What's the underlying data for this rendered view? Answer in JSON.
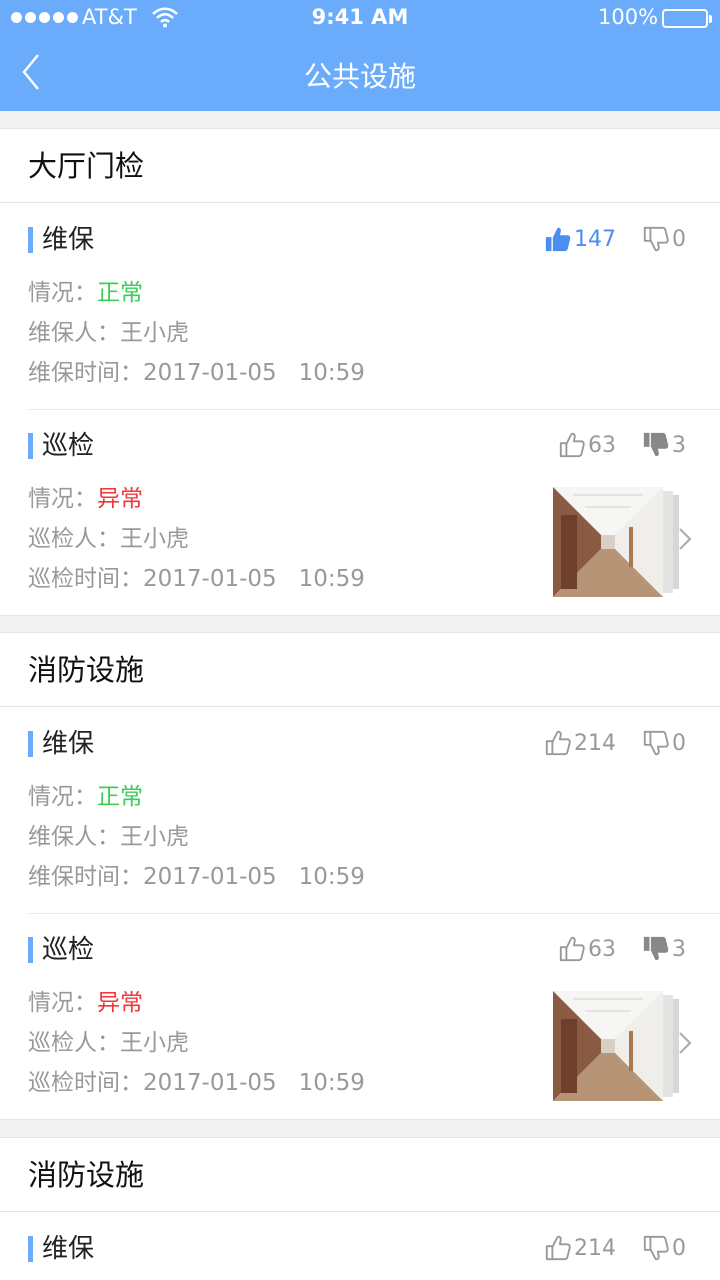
{
  "status_bar": {
    "carrier": "AT&T",
    "time": "9:41 AM",
    "battery": "100%"
  },
  "nav": {
    "title": "公共设施"
  },
  "sections": [
    {
      "title": "大厅门检",
      "records": [
        {
          "title": "维保",
          "status_label": "情况：",
          "status": "正常",
          "person_label": "维保人：",
          "person": "王小虎",
          "time_label": "维保时间：",
          "time": "2017-01-05   10:59",
          "likes": "147",
          "dislikes": "0"
        },
        {
          "title": "巡检",
          "status_label": "情况：",
          "status": "异常",
          "person_label": "巡检人：",
          "person": "王小虎",
          "time_label": "巡检时间：",
          "time": "2017-01-05   10:59",
          "likes": "63",
          "dislikes": "3"
        }
      ]
    },
    {
      "title": "消防设施",
      "records": [
        {
          "title": "维保",
          "status_label": "情况：",
          "status": "正常",
          "person_label": "维保人：",
          "person": "王小虎",
          "time_label": "维保时间：",
          "time": "2017-01-05   10:59",
          "likes": "214",
          "dislikes": "0"
        },
        {
          "title": "巡检",
          "status_label": "情况：",
          "status": "异常",
          "person_label": "巡检人：",
          "person": "王小虎",
          "time_label": "巡检时间：",
          "time": "2017-01-05   10:59",
          "likes": "63",
          "dislikes": "3"
        }
      ]
    },
    {
      "title": "消防设施",
      "records": [
        {
          "title": "维保",
          "likes": "214",
          "dislikes": "0"
        }
      ]
    }
  ],
  "colors": {
    "accent": "#6aacfb",
    "normal": "#3dcc57",
    "abnormal": "#f0383b",
    "like_active": "#4a8ef0"
  },
  "icons": {
    "back": "chevron-left-icon",
    "like": "thumbs-up-icon",
    "dislike": "thumbs-down-icon",
    "wifi": "wifi-icon",
    "battery": "battery-icon"
  }
}
